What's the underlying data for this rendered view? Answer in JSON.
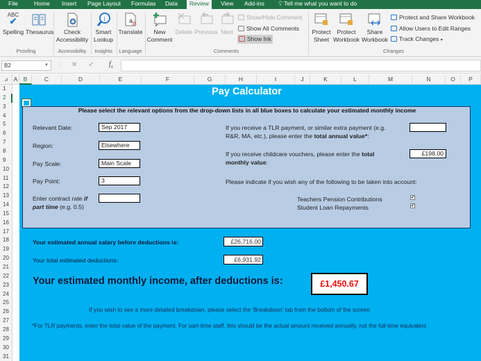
{
  "ribbon_tabs": [
    "File",
    "Home",
    "Insert",
    "Page Layout",
    "Formulas",
    "Data",
    "Review",
    "View",
    "Add-ins"
  ],
  "active_tab": "Review",
  "tell_me": "Tell me what you want to do",
  "ribbon": {
    "proofing": {
      "spelling": "Spelling",
      "thesaurus": "Thesaurus",
      "group": "Proofing",
      "abc": "ABC"
    },
    "accessibility": {
      "check_line1": "Check",
      "check_line2": "Accessibility",
      "group": "Accessibility"
    },
    "insights": {
      "smart_line1": "Smart",
      "smart_line2": "Lookup",
      "group": "Insights"
    },
    "language": {
      "translate": "Translate",
      "group": "Language"
    },
    "comments": {
      "new_line1": "New",
      "new_line2": "Comment",
      "delete": "Delete",
      "previous": "Previous",
      "next": "Next",
      "show_hide": "Show/Hide Comment",
      "show_all": "Show All Comments",
      "show_ink": "Show Ink",
      "group": "Comments"
    },
    "changes": {
      "protect_sheet_1": "Protect",
      "protect_sheet_2": "Sheet",
      "protect_wb_1": "Protect",
      "protect_wb_2": "Workbook",
      "share_wb_1": "Share",
      "share_wb_2": "Workbook",
      "protect_share": "Protect and Share Workbook",
      "allow_users": "Allow Users to Edit Ranges",
      "track_changes": "Track Changes",
      "group": "Changes"
    }
  },
  "formula_bar": {
    "name_box": "B2",
    "formula": ""
  },
  "columns": [
    "A",
    "B",
    "C",
    "D",
    "E",
    "F",
    "G",
    "H",
    "I",
    "J",
    "K",
    "L",
    "M",
    "N",
    "O",
    "P"
  ],
  "selected_column": "B",
  "rows": [
    "1",
    "2",
    "3",
    "4",
    "5",
    "6",
    "7",
    "8",
    "9",
    "10",
    "11",
    "12",
    "13",
    "14",
    "15",
    "16",
    "17",
    "18",
    "19",
    "20",
    "21",
    "22",
    "23",
    "24",
    "25",
    "26",
    "27",
    "28",
    "29",
    "30",
    "31"
  ],
  "calculator": {
    "title": "Pay Calculator",
    "instruction": "Please select the relevant options from the drop-down lists in all blue boxes to calculate your estimated monthly income",
    "fields": {
      "relevant_date": {
        "label": "Relevant Date:",
        "value": "Sep 2017"
      },
      "region": {
        "label": "Region:",
        "value": "Elsewhere"
      },
      "pay_scale": {
        "label": "Pay Scale:",
        "value": "Main Scale"
      },
      "pay_point": {
        "label": "Pay Point:",
        "value": "3"
      },
      "contract_rate": {
        "label_pre": "Enter contract rate ",
        "label_bold1": "if",
        "label_bold2": "part time",
        "label_post": " (e.g. 0.5)",
        "value": ""
      }
    },
    "tlr": {
      "text_pre": "If you receive a TLR payment, or similar extra payment (e.g. R&R, MA, etc.), please enter the ",
      "text_bold": "total annual value*",
      "text_post": ":",
      "value": ""
    },
    "childcare": {
      "text_pre": "If you receive childcare vouchers, please enter the ",
      "text_bold_1": "total",
      "text_bold_2": "monthly value",
      "text_post": ":",
      "value": "£198.00"
    },
    "account_prompt": "Please indicate if you wish any of the following to be taken into account:",
    "options": [
      {
        "label": "Teachers Pension Contributions",
        "checked": true
      },
      {
        "label": "Student Loan Repayments",
        "checked": true
      }
    ],
    "results": {
      "annual_label": "Your estimated annual salary before deductions is:",
      "annual_value": "£26,716.00",
      "deductions_label": "Your total estimated deductions:",
      "deductions_value": "£6,931.92",
      "monthly_label": "Your estimated monthly income, after deductions is:",
      "monthly_value": "£1,450.67"
    },
    "note_breakdown": "If you wish to see a more detailed breakdown, please select the 'Breakdown' tab from the bottom of the screen",
    "note_tlr": "*For TLR payments, enter the total value of the payment. For part-time staff, this should be the actual amount received annually, not the full-time equivalent",
    "colors": {
      "sheet_bg": "#00b0f0",
      "panel_bg": "#b8cce4",
      "monthly_value": "#e11111",
      "excel_green": "#217346"
    }
  }
}
